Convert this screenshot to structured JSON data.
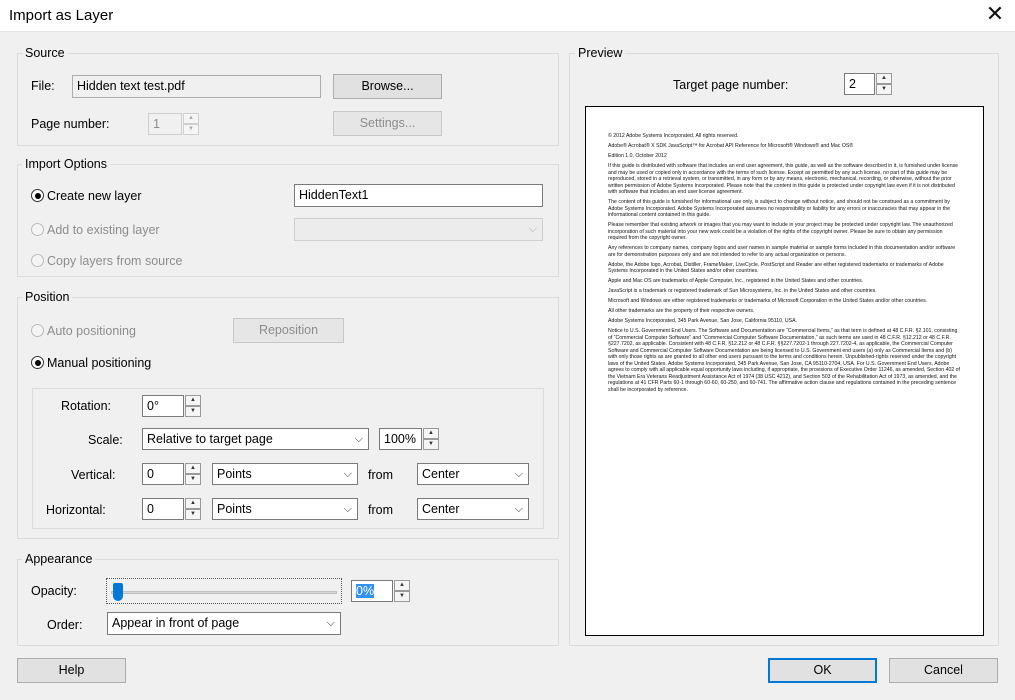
{
  "window": {
    "title": "Import as Layer"
  },
  "source": {
    "label": "Source",
    "file_label": "File:",
    "file_value": "Hidden text test.pdf",
    "browse_label": "Browse...",
    "page_label": "Page number:",
    "page_value": "1",
    "settings_label": "Settings..."
  },
  "import_options": {
    "label": "Import Options",
    "create_new": "Create new layer",
    "layer_name": "HiddenText1",
    "add_existing": "Add to existing layer",
    "copy_layers": "Copy layers from source"
  },
  "position": {
    "label": "Position",
    "auto": "Auto positioning",
    "reposition_label": "Reposition",
    "manual": "Manual positioning",
    "rotation_label": "Rotation:",
    "rotation_value": "0°",
    "scale_label": "Scale:",
    "scale_mode": "Relative to target page",
    "scale_value": "100%",
    "vertical_label": "Vertical:",
    "vertical_value": "0",
    "vertical_unit": "Points",
    "vertical_from": "from",
    "vertical_anchor": "Center",
    "horizontal_label": "Horizontal:",
    "horizontal_value": "0",
    "horizontal_unit": "Points",
    "horizontal_from": "from",
    "horizontal_anchor": "Center"
  },
  "appearance": {
    "label": "Appearance",
    "opacity_label": "Opacity:",
    "opacity_fraction": 0,
    "opacity_value": "0%",
    "order_label": "Order:",
    "order_value": "Appear in front of page"
  },
  "preview": {
    "label": "Preview",
    "target_label": "Target page number:",
    "target_value": "2",
    "doc_lines": [
      "© 2012 Adobe Systems Incorporated. All rights reserved.",
      "Adobe® Acrobat® X SDK JavaScript™ for Acrobat API Reference for Microsoft® Windows® and Mac OS®",
      "Edition 1.0, October 2012",
      "If this guide is distributed with software that includes an end user agreement, this guide, as well as the software described in it, is furnished under license and may be used or copied only in accordance with the terms of such license. Except as permitted by any such license, no part of this guide may be reproduced, stored in a retrieval system, or transmitted, in any form or by any means, electronic, mechanical, recording, or otherwise, without the prior written permission of Adobe Systems Incorporated. Please note that the content in this guide is protected under copyright law even if it is not distributed with software that includes an end user license agreement.",
      "The content of this guide is furnished for informational use only, is subject to change without notice, and should not be construed as a commitment by Adobe Systems Incorporated. Adobe Systems Incorporated assumes no responsibility or liability for any errors or inaccuracies that may appear in the informational content contained in this guide.",
      "Please remember that existing artwork or images that you may want to include in your project may be protected under copyright law. The unauthorized incorporation of such material into your new work could be a violation of the rights of the copyright owner. Please be sure to obtain any permission required from the copyright owner.",
      "Any references to company names, company logos and user names in sample material or sample forms included in this documentation and/or software are for demonstration purposes only and are not intended to refer to any actual organization or persons.",
      "Adobe, the Adobe logo, Acrobat, Distiller, FrameMaker, LiveCycle, PostScript and Reader are either registered trademarks or trademarks of Adobe Systems Incorporated in the United States and/or other countries.",
      "Apple and Mac OS are trademarks of Apple Computer, Inc., registered in the United States and other countries.",
      "JavaScript is a trademark or registered trademark of Sun Microsystems, Inc. in the United States and other countries.",
      "Microsoft and Windows are either registered trademarks or trademarks of Microsoft Corporation in the United States and/or other countries.",
      "All other trademarks are the property of their respective owners.",
      "Adobe Systems Incorporated, 345 Park Avenue, San Jose, California 95110, USA.",
      "Notice to U.S. Government End Users. The Software and Documentation are “Commercial Items,” as that term is defined at 48 C.F.R. §2.101, consisting of “Commercial Computer Software” and “Commercial Computer Software Documentation,” as such terms are used in 48 C.F.R. §12.212 or 48 C.F.R. §227.7202, as applicable. Consistent with 48 C.F.R. §12.212 or 48 C.F.R. §§227.7202-1 through 227.7202-4, as applicable, the Commercial Computer Software and Commercial Computer Software Documentation are being licensed to U.S. Government end users (a) only as Commercial Items and (b) with only those rights as are granted to all other end users pursuant to the terms and conditions herein. Unpublished-rights reserved under the copyright laws of the United States. Adobe Systems Incorporated, 345 Park Avenue, San Jose, CA 95110-2704, USA. For U.S. Government End Users, Adobe agrees to comply with all applicable equal opportunity laws including, if appropriate, the provisions of Executive Order 11246, as amended, Section 402 of the Vietnam Era Veterans Readjustment Assistance Act of 1974 (38 USC 4212), and Section 503 of the Rehabilitation Act of 1973, as amended, and the regulations at 41 CFR Parts 60-1 through 60-60, 60-250, and 60-741. The affirmative action clause and regulations contained in the preceding sentence shall be incorporated by reference."
    ]
  },
  "footer": {
    "help_label": "Help",
    "ok_label": "OK",
    "cancel_label": "Cancel"
  },
  "icons": {
    "close": "close-icon",
    "caret": "chevron-down-icon",
    "spin": "spinner-arrows-icon"
  }
}
